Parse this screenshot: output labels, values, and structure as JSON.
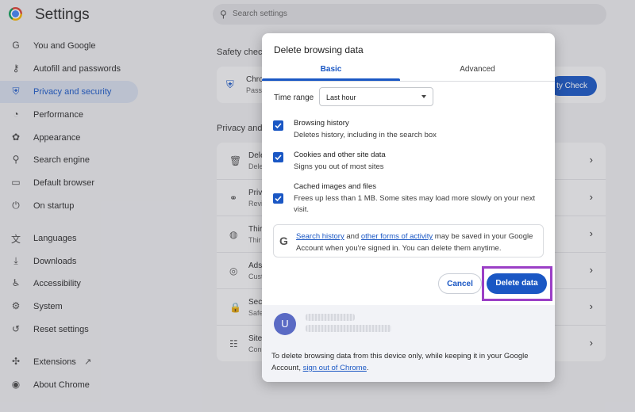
{
  "app": {
    "title": "Settings",
    "search_placeholder": "Search settings"
  },
  "sidebar": {
    "items": [
      {
        "label": "You and Google",
        "icon": "google-g-icon",
        "glyph": "G",
        "active": false
      },
      {
        "label": "Autofill and passwords",
        "icon": "key-icon",
        "glyph": "⚷",
        "active": false
      },
      {
        "label": "Privacy and security",
        "icon": "shield-icon",
        "glyph": "⛨",
        "active": true
      },
      {
        "label": "Performance",
        "icon": "speedometer-icon",
        "glyph": "◔",
        "active": false
      },
      {
        "label": "Appearance",
        "icon": "palette-icon",
        "glyph": "✿",
        "active": false
      },
      {
        "label": "Search engine",
        "icon": "search-icon",
        "glyph": "⚲",
        "active": false
      },
      {
        "label": "Default browser",
        "icon": "browser-icon",
        "glyph": "▭",
        "active": false
      },
      {
        "label": "On startup",
        "icon": "power-icon",
        "glyph": "⏻",
        "active": false
      },
      {
        "label": "Languages",
        "icon": "translate-icon",
        "glyph": "文",
        "active": false
      },
      {
        "label": "Downloads",
        "icon": "download-icon",
        "glyph": "⤓",
        "active": false
      },
      {
        "label": "Accessibility",
        "icon": "accessibility-icon",
        "glyph": "♿",
        "active": false
      },
      {
        "label": "System",
        "icon": "wrench-icon",
        "glyph": "⚙",
        "active": false
      },
      {
        "label": "Reset settings",
        "icon": "reset-icon",
        "glyph": "↺",
        "active": false
      },
      {
        "label": "Extensions",
        "icon": "puzzle-icon",
        "glyph": "✣",
        "active": false
      },
      {
        "label": "About Chrome",
        "icon": "chrome-icon",
        "glyph": "◉",
        "active": false
      }
    ]
  },
  "background": {
    "safety_heading": "Safety chec",
    "safety_row_title": "Chro",
    "safety_row_sub": "Pass",
    "safety_button": "ty Check",
    "privacy_heading": "Privacy and",
    "rows": [
      {
        "t1": "Dele",
        "t2": "Dele",
        "icon": "trash-icon",
        "glyph": "🗑"
      },
      {
        "t1": "Priv",
        "t2": "Revi",
        "icon": "privacy-guide-icon",
        "glyph": "⚭"
      },
      {
        "t1": "Thir",
        "t2": "Thir",
        "icon": "cookie-icon",
        "glyph": "◍"
      },
      {
        "t1": "Ads",
        "t2": "Cust",
        "icon": "ads-icon",
        "glyph": "◎"
      },
      {
        "t1": "Secu",
        "t2": "Safe",
        "icon": "lock-icon",
        "glyph": "🔒"
      },
      {
        "t1": "Site",
        "t2": "Con",
        "icon": "tune-icon",
        "glyph": "☷"
      }
    ]
  },
  "dialog": {
    "title": "Delete browsing data",
    "tabs": [
      {
        "label": "Basic",
        "active": true
      },
      {
        "label": "Advanced",
        "active": false
      }
    ],
    "time_range_label": "Time range",
    "time_range_value": "Last hour",
    "options": [
      {
        "title": "Browsing history",
        "desc": "Deletes history, including in the search box",
        "checked": true
      },
      {
        "title": "Cookies and other site data",
        "desc": "Signs you out of most sites",
        "checked": true
      },
      {
        "title": "Cached images and files",
        "desc": "Frees up less than 1 MB. Some sites may load more slowly on your next visit.",
        "checked": true
      }
    ],
    "google_notice": {
      "link1": "Search history",
      "mid1": " and ",
      "link2": "other forms of activity",
      "rest": " may be saved in your Google Account when you're signed in. You can delete them anytime."
    },
    "cancel_label": "Cancel",
    "delete_label": "Delete data",
    "account_initial": "U",
    "footer_text": "To delete browsing data from this device only, while keeping it in your Google Account, ",
    "footer_link": "sign out of Chrome",
    "footer_end": "."
  },
  "colors": {
    "accent": "#1a57c4",
    "highlight": "#9b3fc6",
    "avatar": "#5a6ac4"
  }
}
